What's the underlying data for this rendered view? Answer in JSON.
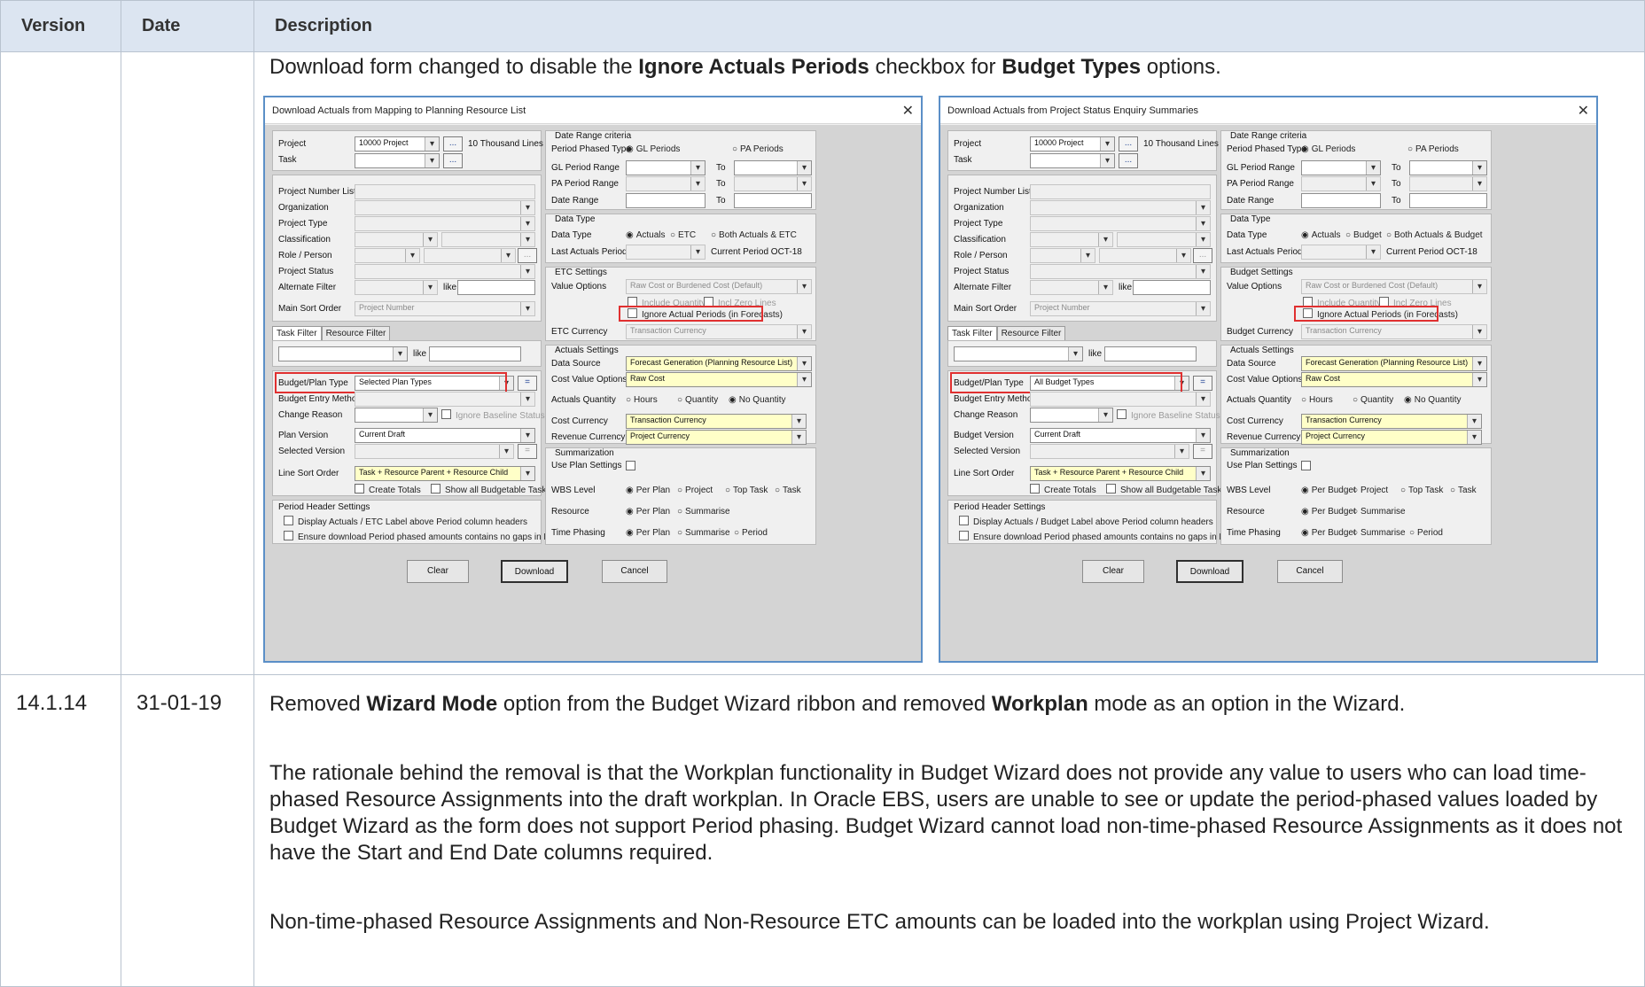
{
  "header": {
    "version": "Version",
    "date": "Date",
    "description": "Description"
  },
  "row1": {
    "intro_pre": "Download form changed to disable the ",
    "intro_b1": "Ignore Actuals Periods",
    "intro_mid": " checkbox for ",
    "intro_b2": "Budget Types",
    "intro_post": " options.",
    "forms": [
      {
        "title": "Download Actuals from Mapping to Planning Resource List",
        "project": "10000 Project",
        "project_desc": "10 Thousand Lines",
        "period_type": "PA Periods",
        "data_type_opt2": "ETC",
        "data_type_opt3": "Both Actuals & ETC",
        "last_period": "Current Period OCT-18",
        "settings_title": "ETC Settings",
        "value_opt": "Raw Cost or Burdened Cost (Default)",
        "ignore_label": "Ignore Actual Periods (in Forecasts)",
        "currency_label": "ETC Currency",
        "currency_val": "Transaction Currency",
        "data_source": "Forecast Generation (Planning Resource List)",
        "cost_value": "Raw Cost",
        "cost_currency": "Transaction Currency",
        "revenue_currency": "Project Currency",
        "budget_type_val": "Selected Plan Types",
        "version_label": "Plan Version",
        "version_val": "Current Draft",
        "line_sort": "Task + Resource Parent + Resource Child",
        "hdr_chk1": "Display Actuals / ETC Label above Period column headers",
        "wbs_per": "Per Plan",
        "res_per": "Per Plan",
        "time_per": "Per Plan"
      },
      {
        "title": "Download Actuals from Project Status Enquiry Summaries",
        "project": "10000 Project",
        "project_desc": "10 Thousand Lines",
        "period_type": "PA Periods",
        "data_type_opt2": "Budget",
        "data_type_opt3": "Both Actuals & Budget",
        "last_period": "Current Period OCT-18",
        "settings_title": "Budget Settings",
        "value_opt": "Raw Cost or Burdened Cost (Default)",
        "ignore_label": "Ignore Actual Periods (in Forecasts)",
        "currency_label": "Budget Currency",
        "currency_val": "Transaction Currency",
        "data_source": "Forecast Generation (Planning Resource List)",
        "cost_value": "Raw Cost",
        "cost_currency": "Transaction Currency",
        "revenue_currency": "Project Currency",
        "budget_type_val": "All Budget Types",
        "version_label": "Budget Version",
        "version_val": "Current Draft",
        "line_sort": "Task + Resource Parent + Resource Child",
        "hdr_chk1": "Display Actuals / Budget Label above Period column headers",
        "wbs_per": "Per Budget",
        "res_per": "Per Budget",
        "time_per": "Per Budget"
      }
    ],
    "common": {
      "project": "Project",
      "task": "Task",
      "dots": "...",
      "range_title": "Date Range criteria",
      "period_phased": "Period Phased Type",
      "gl_periods": "GL Periods",
      "gl_range": "GL Period Range",
      "pa_range": "PA Period Range",
      "date_range": "Date Range",
      "to": "To",
      "pnl": "Project Number List",
      "org": "Organization",
      "ptype": "Project Type",
      "class": "Classification",
      "role": "Role / Person",
      "pstatus": "Project Status",
      "alt": "Alternate Filter",
      "like": "like",
      "main_sort": "Main Sort Order",
      "proj_num": "Project Number",
      "tab1": "Task Filter",
      "tab2": "Resource Filter",
      "dt_title": "Data Type",
      "dt": "Data Type",
      "actuals": "Actuals",
      "last_actuals": "Last Actuals Period",
      "value_options": "Value Options",
      "incl_qty": "Include Quantity",
      "incl_zero": "Incl Zero Lines",
      "act_title": "Actuals Settings",
      "data_source": "Data Source",
      "cost_value_opts": "Cost Value Options",
      "act_qty": "Actuals Quantity",
      "hours": "Hours",
      "quantity": "Quantity",
      "no_qty": "No Quantity",
      "cost_cur": "Cost Currency",
      "rev_cur": "Revenue Currency",
      "budget_plan": "Budget/Plan Type",
      "bem": "Budget Entry Method",
      "change": "Change Reason",
      "ignore_baseline": "Ignore Baseline Status",
      "sel_version": "Selected Version",
      "eq": "=",
      "line_sort_order": "Line Sort Order",
      "create_totals": "Create Totals",
      "show_all": "Show all Budgetable Tasks",
      "phs_title": "Period Header Settings",
      "hdr_chk2": "Ensure download Period phased amounts contains no gaps in Periods",
      "sum_title": "Summarization",
      "use_plan": "Use Plan Settings",
      "wbs": "WBS Level",
      "project_lbl": "Project",
      "top_task": "Top Task",
      "task_lbl": "Task",
      "resource": "Resource",
      "summarise": "Summarise",
      "time_phasing": "Time Phasing",
      "period": "Period",
      "clear": "Clear",
      "download": "Download",
      "cancel": "Cancel",
      "close": "✕"
    }
  },
  "row2": {
    "version": "14.1.14",
    "date": "31-01-19",
    "p1_pre": "Removed ",
    "p1_b1": "Wizard Mode",
    "p1_mid": " option from the Budget Wizard ribbon and removed ",
    "p1_b2": "Workplan",
    "p1_post": " mode as an option in the Wizard.",
    "p2": "The rationale behind the removal is that the Workplan functionality in Budget Wizard does not provide any value to users who can load time-phased Resource Assignments into the draft workplan.  In Oracle EBS, users are unable to see or update the period-phased values loaded by Budget Wizard as the form does not support Period phasing.  Budget Wizard cannot load non-time-phased Resource Assignments as it does not have the Start and End Date columns required.",
    "p3": "Non-time-phased Resource Assignments and Non-Resource ETC amounts can be loaded into the workplan using Project Wizard."
  }
}
